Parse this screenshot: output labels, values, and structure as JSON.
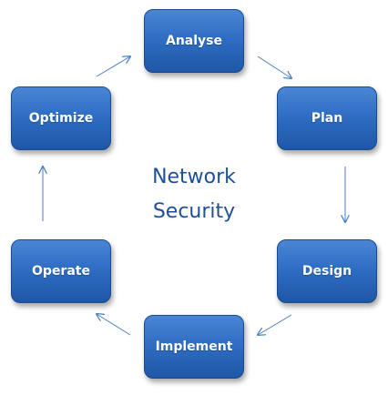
{
  "diagram": {
    "center_title_line1": "Network",
    "center_title_line2": "Security",
    "steps": [
      {
        "label": "Analyse"
      },
      {
        "label": "Plan"
      },
      {
        "label": "Design"
      },
      {
        "label": "Implement"
      },
      {
        "label": "Operate"
      },
      {
        "label": "Optimize"
      }
    ]
  },
  "colors": {
    "node_fill": "#2f6ec4",
    "node_border": "#1a4a8e",
    "center_text": "#1f4f9c",
    "arrow": "#4a7ec4"
  }
}
